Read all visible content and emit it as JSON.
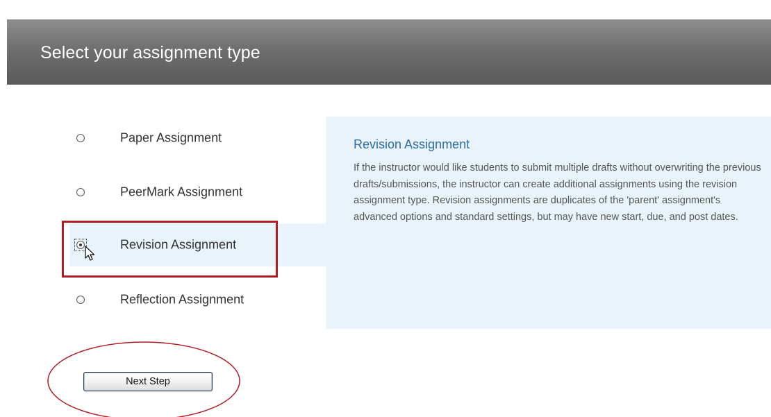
{
  "header": {
    "title": "Select your assignment type"
  },
  "options": [
    {
      "label": "Paper Assignment",
      "selected": false
    },
    {
      "label": "PeerMark Assignment",
      "selected": false
    },
    {
      "label": "Revision Assignment",
      "selected": true
    },
    {
      "label": "Reflection Assignment",
      "selected": false
    }
  ],
  "info": {
    "title": "Revision Assignment",
    "body": "If the instructor would like students to submit multiple drafts without overwriting the previous drafts/submissions, the instructor can create additional assignments using the revision assignment type. Revision assignments are duplicates of the 'parent' assignment's advanced options and standard settings, but may have new start, due, and post dates."
  },
  "next_button": {
    "label": "Next Step"
  },
  "colors": {
    "header_bg": "#6f6f6f",
    "panel_bg": "#e8f3fb",
    "info_title": "#2d6da3",
    "annotation": "#b01e24"
  },
  "icons": {
    "cursor": "mouse-pointer-icon"
  }
}
